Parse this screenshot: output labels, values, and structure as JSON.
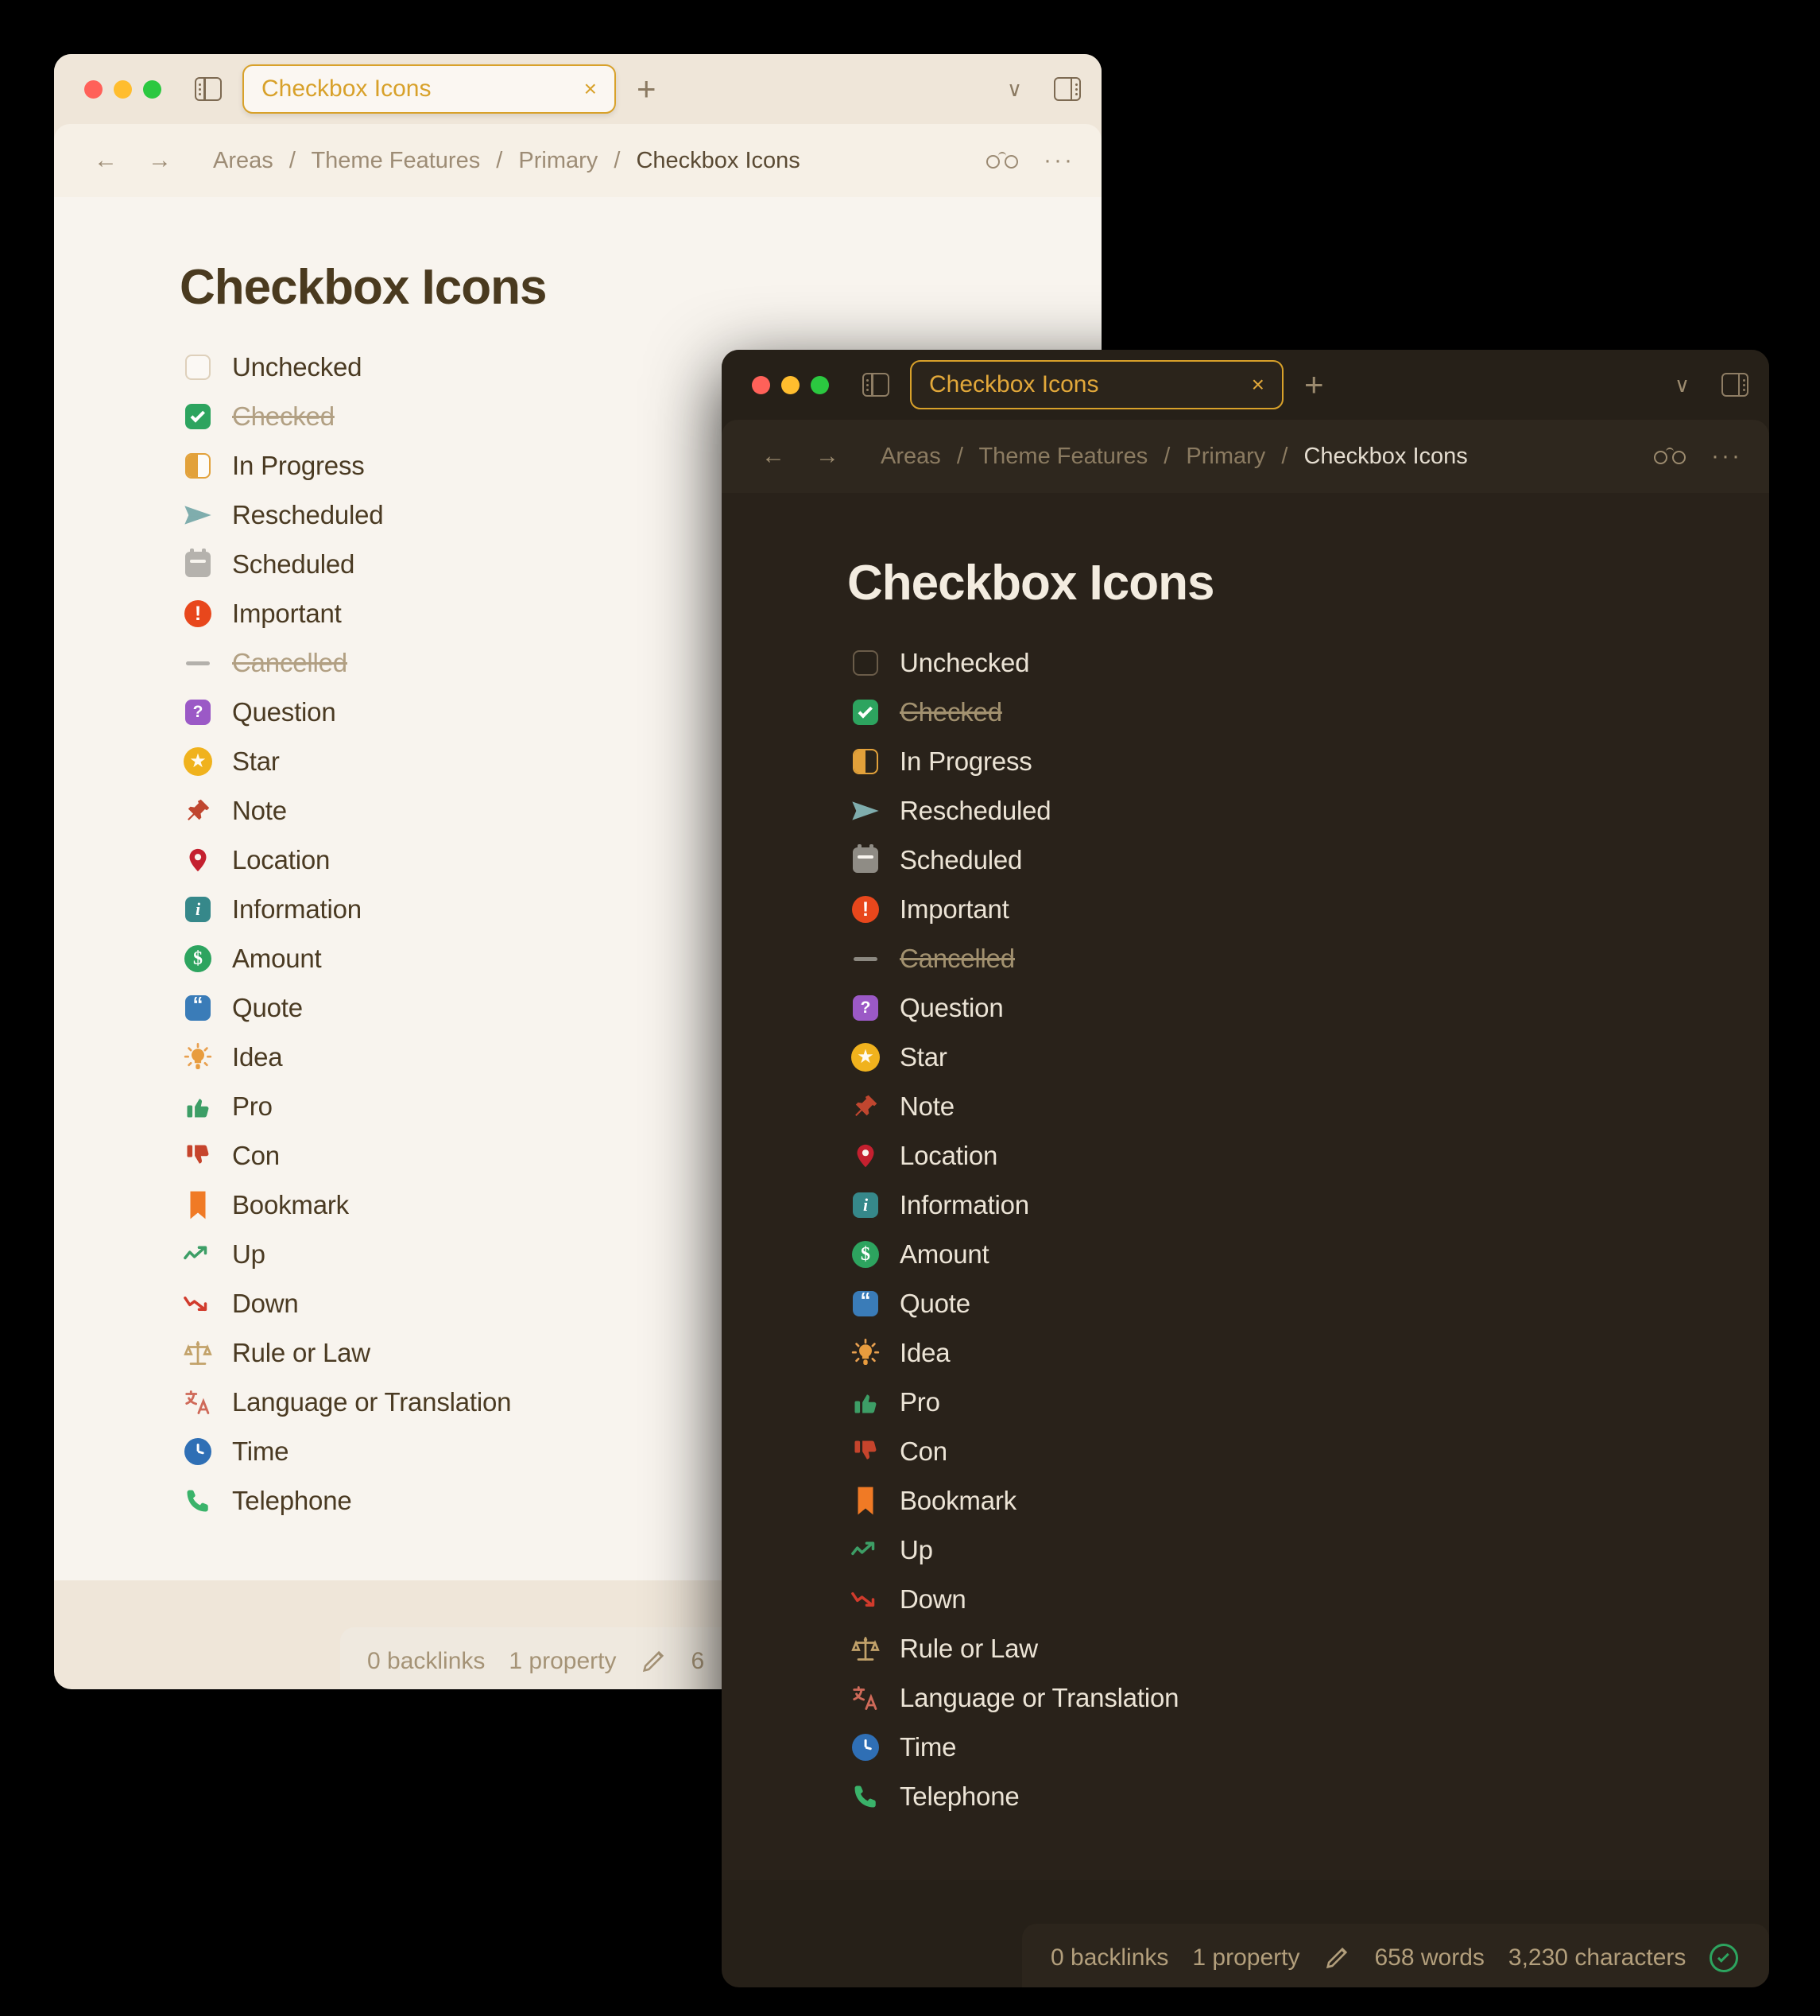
{
  "windows": {
    "light": {
      "tab_title": "Checkbox Icons",
      "tab_close": "×",
      "new_tab": "+",
      "chevron": "∨",
      "back_arrow": "←",
      "forward_arrow": "→",
      "more": "···",
      "breadcrumb": [
        "Areas",
        "Theme Features",
        "Primary",
        "Checkbox Icons"
      ],
      "breadcrumb_separator": "/",
      "doc_title": "Checkbox Icons",
      "status": {
        "backlinks": "0 backlinks",
        "properties": "1 property",
        "words": "6",
        "characters": ""
      }
    },
    "dark": {
      "tab_title": "Checkbox Icons",
      "tab_close": "×",
      "new_tab": "+",
      "chevron": "∨",
      "back_arrow": "←",
      "forward_arrow": "→",
      "more": "···",
      "breadcrumb": [
        "Areas",
        "Theme Features",
        "Primary",
        "Checkbox Icons"
      ],
      "breadcrumb_separator": "/",
      "doc_title": "Checkbox Icons",
      "status": {
        "backlinks": "0 backlinks",
        "properties": "1 property",
        "words": "658 words",
        "characters": "3,230 characters"
      }
    }
  },
  "checkbox_items": [
    {
      "label": "Unchecked",
      "icon": "unchecked-checkbox-icon",
      "struck": false
    },
    {
      "label": "Checked",
      "icon": "checked-checkbox-icon",
      "struck": true
    },
    {
      "label": "In Progress",
      "icon": "in-progress-icon",
      "struck": false
    },
    {
      "label": "Rescheduled",
      "icon": "rescheduled-arrow-icon",
      "struck": false
    },
    {
      "label": "Scheduled",
      "icon": "calendar-icon",
      "struck": false
    },
    {
      "label": "Important",
      "icon": "important-exclamation-icon",
      "struck": false
    },
    {
      "label": "Cancelled",
      "icon": "cancelled-dash-icon",
      "struck": true
    },
    {
      "label": "Question",
      "icon": "question-mark-icon",
      "struck": false
    },
    {
      "label": "Star",
      "icon": "star-icon",
      "struck": false
    },
    {
      "label": "Note",
      "icon": "pushpin-icon",
      "struck": false
    },
    {
      "label": "Location",
      "icon": "location-pin-icon",
      "struck": false
    },
    {
      "label": "Information",
      "icon": "information-icon",
      "struck": false
    },
    {
      "label": "Amount",
      "icon": "dollar-amount-icon",
      "struck": false
    },
    {
      "label": "Quote",
      "icon": "quote-icon",
      "struck": false
    },
    {
      "label": "Idea",
      "icon": "lightbulb-idea-icon",
      "struck": false
    },
    {
      "label": "Pro",
      "icon": "thumbs-up-icon",
      "struck": false
    },
    {
      "label": "Con",
      "icon": "thumbs-down-icon",
      "struck": false
    },
    {
      "label": "Bookmark",
      "icon": "bookmark-icon",
      "struck": false
    },
    {
      "label": "Up",
      "icon": "trend-up-icon",
      "struck": false
    },
    {
      "label": "Down",
      "icon": "trend-down-icon",
      "struck": false
    },
    {
      "label": "Rule or Law",
      "icon": "scales-icon",
      "struck": false
    },
    {
      "label": "Language or Translation",
      "icon": "translate-icon",
      "struck": false
    },
    {
      "label": "Time",
      "icon": "clock-icon",
      "struck": false
    },
    {
      "label": "Telephone",
      "icon": "telephone-icon",
      "struck": false
    }
  ],
  "colors": {
    "accent_amber": "#d8a12a",
    "checked_green": "#2da45f",
    "in_progress_orange": "#e2a13a",
    "rescheduled_teal": "#7fadad",
    "important_red": "#e8471c",
    "question_purple": "#9b59c6",
    "star_yellow": "#f0b21d",
    "note_red": "#c0462f",
    "location_crimson": "#c4202f",
    "info_teal": "#36888a",
    "quote_blue": "#3a7cb8",
    "bookmark_orange": "#f07a25",
    "time_blue": "#2f6fb5",
    "law_tan": "#c2a26a"
  }
}
